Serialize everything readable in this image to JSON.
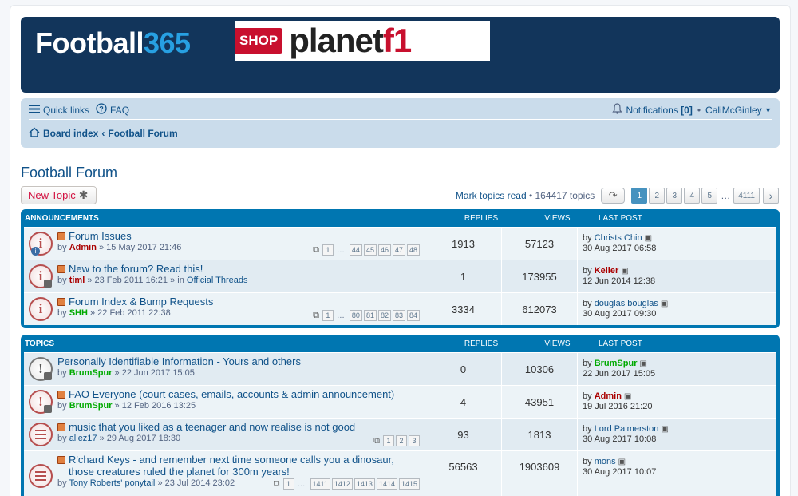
{
  "header": {
    "logo1_main": "Football",
    "logo1_num": "365",
    "shop": "SHOP",
    "planet": "planet",
    "f1": "f1"
  },
  "nav": {
    "quick_links": "Quick links",
    "faq": "FAQ",
    "notifications": "Notifications",
    "notif_count": "[0]",
    "bullet": "•",
    "user": "CaliMcGinley",
    "board_index": "Board index",
    "crumb_sep": "‹",
    "forum": "Football Forum"
  },
  "page": {
    "title": "Football Forum",
    "new_topic": "New Topic",
    "mark_read": "Mark topics read",
    "topics_count": "• 164417 topics",
    "pages": [
      "1",
      "2",
      "3",
      "4",
      "5"
    ],
    "ellipsis": "…",
    "last_page": "4111",
    "next": "›"
  },
  "announcements": {
    "header": "Announcements",
    "col_replies": "Replies",
    "col_views": "Views",
    "col_last": "Last post",
    "rows": [
      {
        "title": "Forum Issues",
        "by": "by",
        "author": "Admin",
        "date": "» 15 May 2017 21:46",
        "replies": "1913",
        "views": "57123",
        "lp_by": "by",
        "lp_user": "Christs Chin",
        "lp_date": "30 Aug 2017 06:58",
        "pages": [
          "1",
          "44",
          "45",
          "46",
          "47",
          "48"
        ]
      },
      {
        "title": "New to the forum? Read this!",
        "by": "by",
        "author": "timl",
        "date": "» 23 Feb 2011 16:21 » in",
        "forum_link": "Official Threads",
        "replies": "1",
        "views": "173955",
        "lp_by": "by",
        "lp_user": "Keller",
        "lp_date": "12 Jun 2014 12:38"
      },
      {
        "title": "Forum Index & Bump Requests",
        "by": "by",
        "author": "SHH",
        "date": "» 22 Feb 2011 22:38",
        "replies": "3334",
        "views": "612073",
        "lp_by": "by",
        "lp_user": "douglas bouglas",
        "lp_date": "30 Aug 2017 09:30",
        "pages": [
          "1",
          "80",
          "81",
          "82",
          "83",
          "84"
        ]
      }
    ]
  },
  "topics": {
    "header": "Topics",
    "col_replies": "Replies",
    "col_views": "Views",
    "col_last": "Last post",
    "rows": [
      {
        "title": "Personally Identifiable Information - Yours and others",
        "by": "by",
        "author": "BrumSpur",
        "date": "» 22 Jun 2017 15:05",
        "replies": "0",
        "views": "10306",
        "lp_by": "by",
        "lp_user": "BrumSpur",
        "lp_date": "22 Jun 2017 15:05"
      },
      {
        "title": "FAO Everyone (court cases, emails, accounts & admin announcement)",
        "by": "by",
        "author": "BrumSpur",
        "date": "» 12 Feb 2016 13:25",
        "replies": "4",
        "views": "43951",
        "lp_by": "by",
        "lp_user": "Admin",
        "lp_date": "19 Jul 2016 21:20"
      },
      {
        "title": "music that you liked as a teenager and now realise is not good",
        "by": "by",
        "author": "allez17",
        "date": "» 29 Aug 2017 18:30",
        "replies": "93",
        "views": "1813",
        "lp_by": "by",
        "lp_user": "Lord Palmerston",
        "lp_date": "30 Aug 2017 10:08",
        "pages": [
          "1",
          "2",
          "3"
        ]
      },
      {
        "title": "R'chard Keys - and remember next time someone calls you a dinosaur, those creatures ruled the planet for 300m years!",
        "by": "by",
        "author": "Tony Roberts' ponytail",
        "date": "» 23 Jul 2014 23:02",
        "replies": "56563",
        "views": "1903609",
        "lp_by": "by",
        "lp_user": "mons",
        "lp_date": "30 Aug 2017 10:07",
        "pages": [
          "1",
          "1411",
          "1412",
          "1413",
          "1414",
          "1415"
        ]
      }
    ]
  }
}
